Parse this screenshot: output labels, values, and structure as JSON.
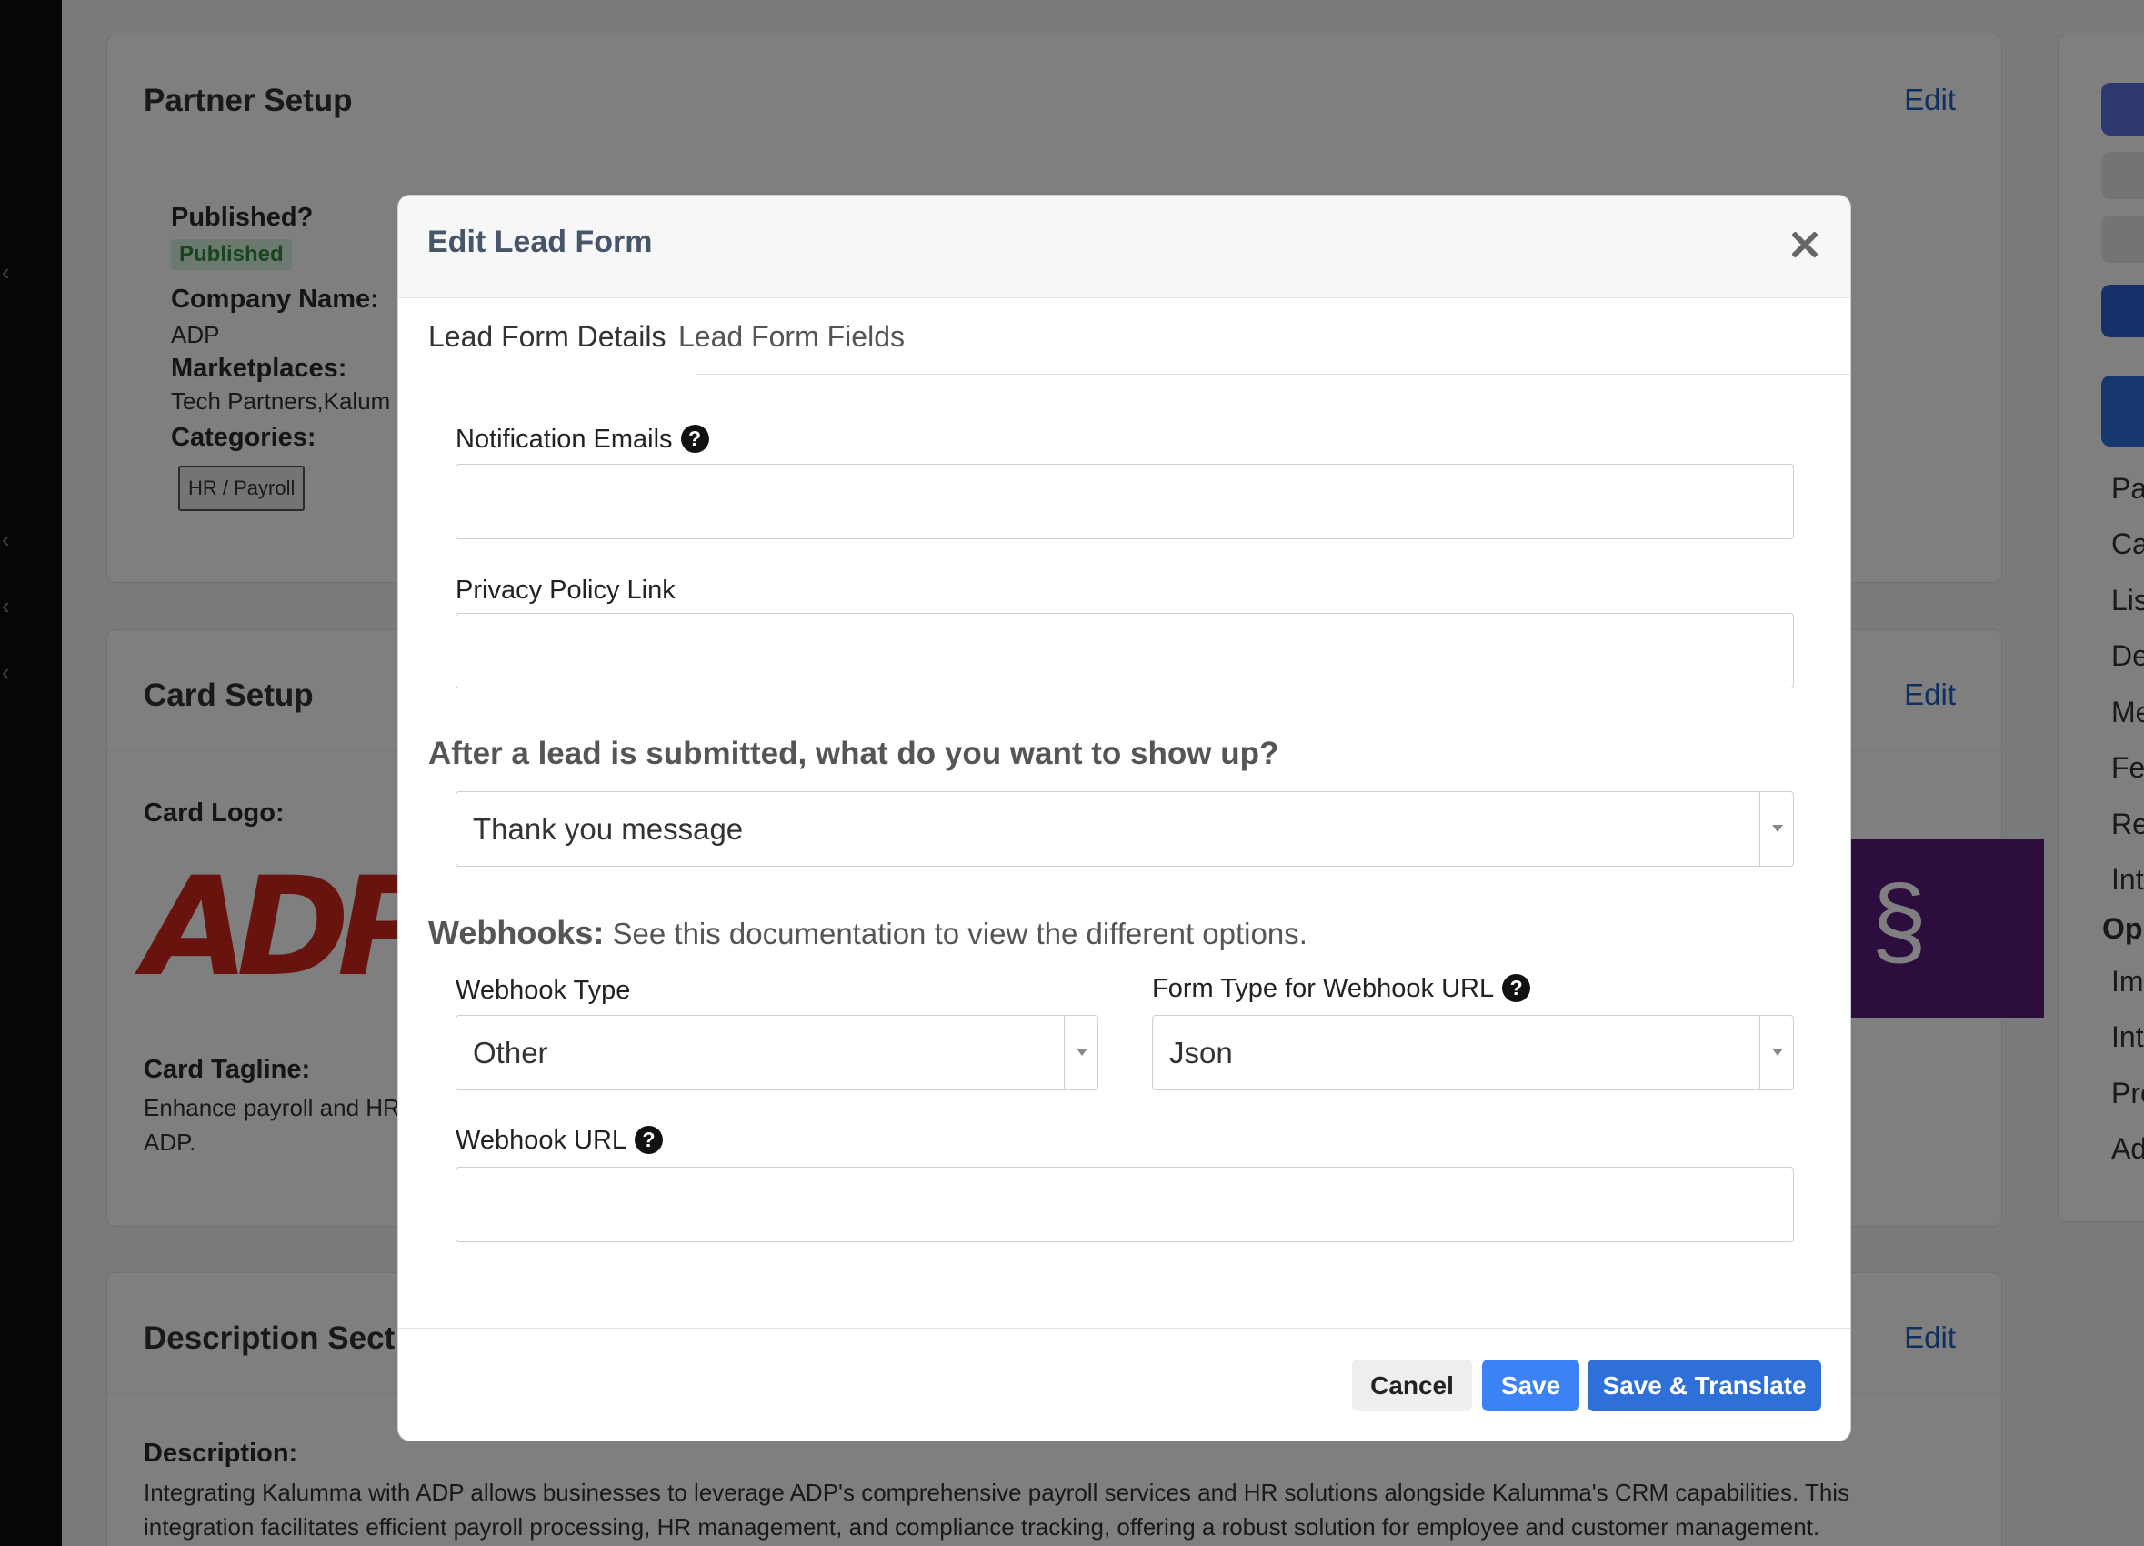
{
  "background": {
    "partner_setup": {
      "title": "Partner Setup",
      "edit": "Edit",
      "published_label": "Published?",
      "published_badge": "Published",
      "company_label": "Company Name:",
      "company_value": "ADP",
      "marketplaces_label": "Marketplaces:",
      "marketplaces_value": "Tech Partners,Kalum",
      "categories_label": "Categories:",
      "category_tag": "HR / Payroll"
    },
    "card_setup": {
      "title": "Card Setup",
      "edit": "Edit",
      "logo_label": "Card Logo:",
      "logo_text": "ADP",
      "tagline_label": "Card Tagline:",
      "tagline_line1": "Enhance payroll and HR",
      "tagline_line2": "ADP."
    },
    "description_section": {
      "title": "Description Sect",
      "edit": "Edit",
      "description_label": "Description:",
      "description_line1": "Integrating Kalumma with ADP allows businesses to leverage ADP's comprehensive payroll services and HR solutions alongside Kalumma's CRM capabilities. This",
      "description_line2": "integration facilitates efficient payroll processing, HR management, and compliance tracking, offering a robust solution for employee and customer management."
    },
    "right_nav": [
      "Pa",
      "Ca",
      "Lis",
      "De",
      "Me",
      "Fe",
      "Re",
      "Int",
      "Op",
      "Ima",
      "Int",
      "Pro",
      "Ad"
    ]
  },
  "modal": {
    "title": "Edit Lead Form",
    "tabs": [
      {
        "label": "Lead Form Details",
        "active": true
      },
      {
        "label": "Lead Form Fields",
        "active": false
      }
    ],
    "notification_emails": {
      "label": "Notification Emails",
      "value": ""
    },
    "privacy_policy": {
      "label": "Privacy Policy Link",
      "value": ""
    },
    "after_submit": {
      "question": "After a lead is submitted, what do you want to show up?",
      "selected": "Thank you message"
    },
    "webhooks": {
      "heading": "Webhooks:",
      "description": "See this documentation to view the different options."
    },
    "webhook_type": {
      "label": "Webhook Type",
      "selected": "Other"
    },
    "form_type": {
      "label": "Form Type for Webhook URL",
      "selected": "Json"
    },
    "webhook_url": {
      "label": "Webhook URL",
      "value": ""
    },
    "buttons": {
      "cancel": "Cancel",
      "save": "Save",
      "save_translate": "Save & Translate"
    }
  },
  "colors": {
    "primary": "#3b82f6",
    "primary_dark": "#2f6fd8",
    "edit_link": "#1f5fbf",
    "published_bg": "#d9f2dd",
    "published_text": "#2e8b43",
    "adp_red": "#d0271d",
    "purple": "#5b1a7a"
  },
  "icons": {
    "close": "close-icon",
    "help": "question-circle-icon",
    "dropdown": "caret-down-icon",
    "rail": "chevron-left-icon"
  }
}
